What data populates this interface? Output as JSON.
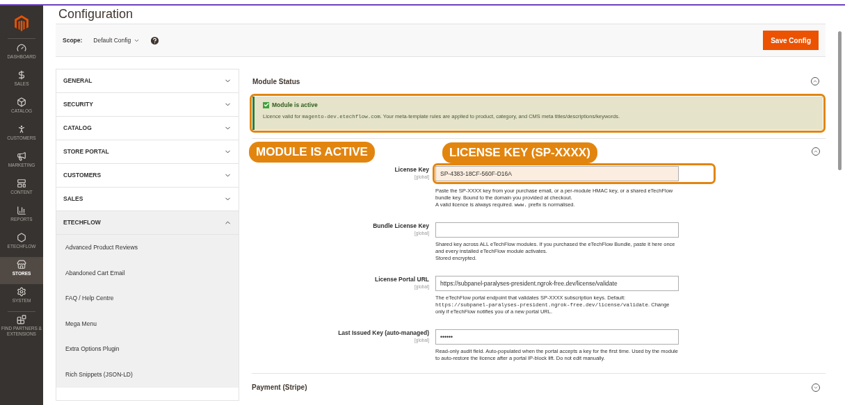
{
  "nav": {
    "items": [
      {
        "label": "DASHBOARD",
        "selected": false
      },
      {
        "label": "SALES",
        "selected": false
      },
      {
        "label": "CATALOG",
        "selected": false
      },
      {
        "label": "CUSTOMERS",
        "selected": false
      },
      {
        "label": "MARKETING",
        "selected": false
      },
      {
        "label": "CONTENT",
        "selected": false
      },
      {
        "label": "REPORTS",
        "selected": false
      },
      {
        "label": "ETECHFLOW",
        "selected": false
      },
      {
        "label": "STORES",
        "selected": true
      },
      {
        "label": "SYSTEM",
        "selected": false
      },
      {
        "label": "FIND PARTNERS & EXTENSIONS",
        "selected": false
      }
    ]
  },
  "page_title": "Configuration",
  "scope": {
    "label": "Scope:",
    "value": "Default Config"
  },
  "save_button": "Save Config",
  "config_tabs": [
    {
      "label": "GENERAL",
      "expanded": false
    },
    {
      "label": "SECURITY",
      "expanded": false
    },
    {
      "label": "CATALOG",
      "expanded": false
    },
    {
      "label": "STORE PORTAL",
      "expanded": false
    },
    {
      "label": "CUSTOMERS",
      "expanded": false
    },
    {
      "label": "SALES",
      "expanded": false
    },
    {
      "label": "ETECHFLOW",
      "expanded": true,
      "children": [
        {
          "label": "Advanced Product Reviews",
          "selected": false
        },
        {
          "label": "Abandoned Cart Email",
          "selected": false
        },
        {
          "label": "FAQ / Help Centre",
          "selected": false
        },
        {
          "label": "Mega Menu",
          "selected": false
        },
        {
          "label": "Extra Options Plugin",
          "selected": false
        },
        {
          "label": "Rich Snippets (JSON-LD)",
          "selected": false
        }
      ]
    }
  ],
  "module_status": {
    "title": "Module Status",
    "expanded": true,
    "notice": {
      "title": "Module is active",
      "checked": true,
      "message": [
        {
          "text": "Licence valid for ",
          "code": false
        },
        {
          "text": "magento-dev.etechflow.com",
          "code": true
        },
        {
          "text": ". Your meta-template rules are applied to product, category, and CMS meta titles/descriptions/keywords.",
          "code": false
        }
      ]
    }
  },
  "license_section": {
    "expanded": true,
    "fields": [
      {
        "label": "License Key",
        "scope": "[global]",
        "value": "SP-4383-18CF-560F-D16A",
        "help": [
          [
            {
              "text": "Paste the SP-XXXX key from your purchase email, or a per-module HMAC key, or a shared eTechFlow bundle key. Bound to the domain you provided at checkout.",
              "code": false
            }
          ],
          [
            {
              "text": "A valid licence is always required. ",
              "code": false
            },
            {
              "text": "www.",
              "code": true
            },
            {
              "text": " prefix is normalised.",
              "code": false
            }
          ]
        ]
      },
      {
        "label": "Bundle License Key",
        "scope": "[global]",
        "help": [
          [
            {
              "text": "Shared key across ALL eTechFlow modules. If you purchased the eTechFlow Bundle, paste it here once and every installed eTechFlow module activates.",
              "code": false
            }
          ],
          [
            {
              "text": "Stored encrypted.",
              "code": false
            }
          ]
        ]
      },
      {
        "label": "License Portal URL",
        "scope": "[global]",
        "value": "https://subpanel-paralyses-president.ngrok-free.dev/license/validate",
        "help": [
          [
            {
              "text": "The eTechFlow portal endpoint that validates SP-XXXX subscription keys. Default: ",
              "code": false
            },
            {
              "text": "https://subpanel-paralyses-president.ngrok-free.dev/license/validate",
              "code": true
            },
            {
              "text": ". Change only if eTechFlow notifies you of a new portal URL.",
              "code": false
            }
          ]
        ]
      },
      {
        "label": "Last Issued Key (auto-managed)",
        "scope": "[global]",
        "value": "••••••",
        "help": [
          [
            {
              "text": "Read-only audit field. Auto-populated when the portal accepts a key for the first time. Used by the module to auto-restore the licence after a portal IP-block lift. Do not edit manually.",
              "code": false
            }
          ]
        ]
      }
    ]
  },
  "payment_section": {
    "title": "Payment (Stripe)",
    "expanded": false
  },
  "annotations": [
    {
      "text": "MODULE IS ACTIVE"
    },
    {
      "text": "LICENSE KEY (SP-XXXX)"
    }
  ]
}
